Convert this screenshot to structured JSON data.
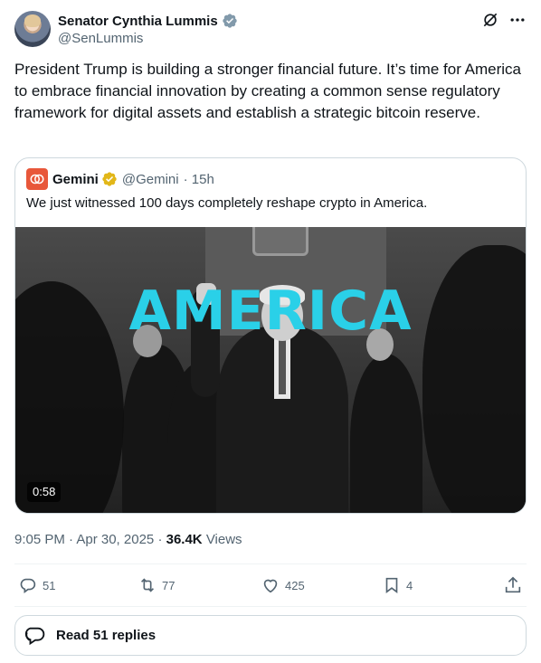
{
  "post": {
    "author_name": "Senator Cynthia Lummis",
    "author_handle": "@SenLummis",
    "text": "President Trump is building a stronger financial future. It’s time for America to embrace financial innovation by creating a common sense regulatory framework for digital assets and establish a strategic bitcoin reserve.",
    "time": "9:05 PM · Apr 30, 2025",
    "views_count": "36.4K",
    "views_label": "Views"
  },
  "quote": {
    "author_name": "Gemini",
    "author_handle": "@Gemini",
    "age": "· 15h",
    "text": "We just witnessed 100 days completely reshape crypto in America.",
    "video_overlay_text": "AMERICA",
    "video_duration": "0:58"
  },
  "actions": {
    "replies": "51",
    "reposts": "77",
    "likes": "425",
    "bookmarks": "4"
  },
  "read_replies_label": "Read 51 replies",
  "icons": [
    "verified-blue-icon",
    "grok-icon",
    "more-icon",
    "verified-gold-icon",
    "reply-icon",
    "repost-icon",
    "like-icon",
    "bookmark-icon",
    "share-icon",
    "replies-bubble-icon"
  ],
  "colors": {
    "verified_blue": "#1d9bf0",
    "verified_gold": "#e2b719",
    "overlay_cyan": "#2ad0e8",
    "secondary_text": "#536471"
  }
}
